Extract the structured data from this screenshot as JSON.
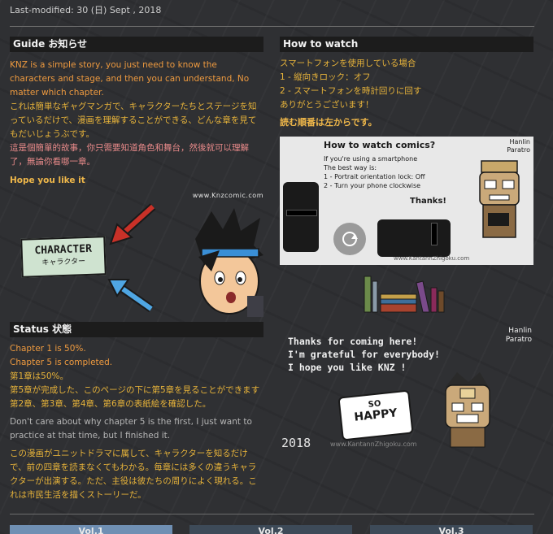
{
  "last_modified": "Last-modified: 30 (日) Sept , 2018",
  "guide": {
    "heading": "Guide  お知らせ",
    "en": "KNZ is a simple story, you just need to know the characters and stage, and then you can understand, No matter which chapter.",
    "ja": "これは簡単なギャグマンガで、キャラクターたちとステージを知っているだけで、漫画を理解することができる、どんな章を見てもだいじょうぶです。",
    "zh": "這是個簡單的故事，你只需要知道角色和舞台，然後就可以理解了，無論你看哪一章。",
    "hope": "Hope you like it",
    "watermark": "www.Knzcomic.com",
    "sign_en": "CHARACTER",
    "sign_ja": "キャラクター"
  },
  "how": {
    "heading": "How to watch",
    "lines": [
      "スマートフォンを使用している場合",
      "1 - 縦向きロック：オフ",
      "2 - スマートフォンを時計回りに回す",
      "ありがとうございます！"
    ],
    "note": "読む順番は左からです。",
    "panel": {
      "title": "How to watch comics?",
      "sub1": "If you're using a smartphone",
      "sub2": "The best way is:",
      "s1": "1 - Portrait orientation lock: Off",
      "s2": "2 - Turn your phone clockwise",
      "thanks": "Thanks!",
      "sig1": "Hanlin",
      "sig2": "Paratro",
      "url": "www.KantannZhigoku.com"
    }
  },
  "status": {
    "heading": "Status 状態",
    "ch1": "Chapter 1 is 50%.",
    "ch5": "Chapter 5 is completed.",
    "ja1": "第1章は50%。",
    "ja2": "第5章が完成した、このページの下に第5章を見ることができます",
    "ja3": "第2章、第3章、第4章、第6章の表紙絵を確認した。",
    "en2": "Don't care about why chapter 5 is the first, I just want to practice at that time, but I finished it.",
    "ja4": "この漫画がユニットドラマに属して、キャラクターを知るだけで、前の四章を読まなくてもわかる。毎章には多くの違うキャラクターが出演する。ただ、主役は彼たちの周りによく現れる。これは市民生活を描くストーリーだ。"
  },
  "thanks_art": {
    "l1": "Thanks for coming here!",
    "l2": "I'm grateful for everybody!",
    "l3": "I hope you like KNZ !",
    "bubble1": "SO",
    "bubble2": "HAPPY",
    "year": "2018",
    "sig1": "Hanlin",
    "sig2": "Paratro",
    "url": "www.KantannZhigoku.com"
  },
  "tabs": [
    "Vol.1",
    "Vol.2",
    "Vol.3"
  ]
}
